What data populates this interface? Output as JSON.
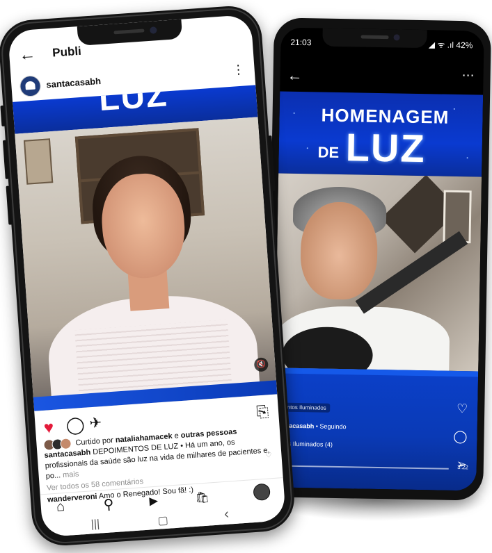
{
  "back_phone": {
    "status": {
      "time": "21:03",
      "battery": "42%",
      "signal_icons": "◢ ᯤ .ıl"
    },
    "nav": {
      "back_icon": "←",
      "more_icon": "⋯"
    },
    "banner": {
      "line1": "HOMENAGEM",
      "line2": "DE",
      "line3": "LUZ"
    },
    "overlay": {
      "playlist_tag": "entos Iluminados",
      "username": "antacasabh",
      "follow_text": "• Seguindo",
      "playlist_label": "ntos Iluminados (4)",
      "duration": "3:22"
    },
    "side_icons": {
      "heart": "♡",
      "comment": "◯",
      "share": "➢"
    }
  },
  "front_phone": {
    "header": {
      "back_icon": "←",
      "title": "Publi"
    },
    "account": {
      "username": "santacasabh",
      "more_icon": "⋮"
    },
    "banner": {
      "text": "LUZ"
    },
    "mute_icon": "🔇",
    "actions": {
      "like_icon": "♥",
      "comment_icon": "◯",
      "share_icon": "✈",
      "save_icon": "⎘"
    },
    "caption": {
      "liked_prefix": "Curtido por",
      "liked_user": "nataliahamacek",
      "liked_suffix": "e",
      "liked_others": "outras pessoas",
      "owner": "santacasabh",
      "text": "DEPOIMENTOS DE LUZ • Há um ano, os profissionais da saúde são luz na vida de milhares de pacientes e, po...",
      "more": "mais",
      "view_comments": "Ver todos os 58 comentários",
      "comment_user": "wanderveroni",
      "comment_text": "Amo o Renegado! Sou fã! :)",
      "comment_heart": "♡"
    },
    "tabbar": {
      "home": "⌂",
      "search": "⚲",
      "reels": "▶",
      "shop": "🛍"
    },
    "sysnav": {
      "recents": "|||",
      "home": "▢",
      "back": "‹"
    }
  }
}
